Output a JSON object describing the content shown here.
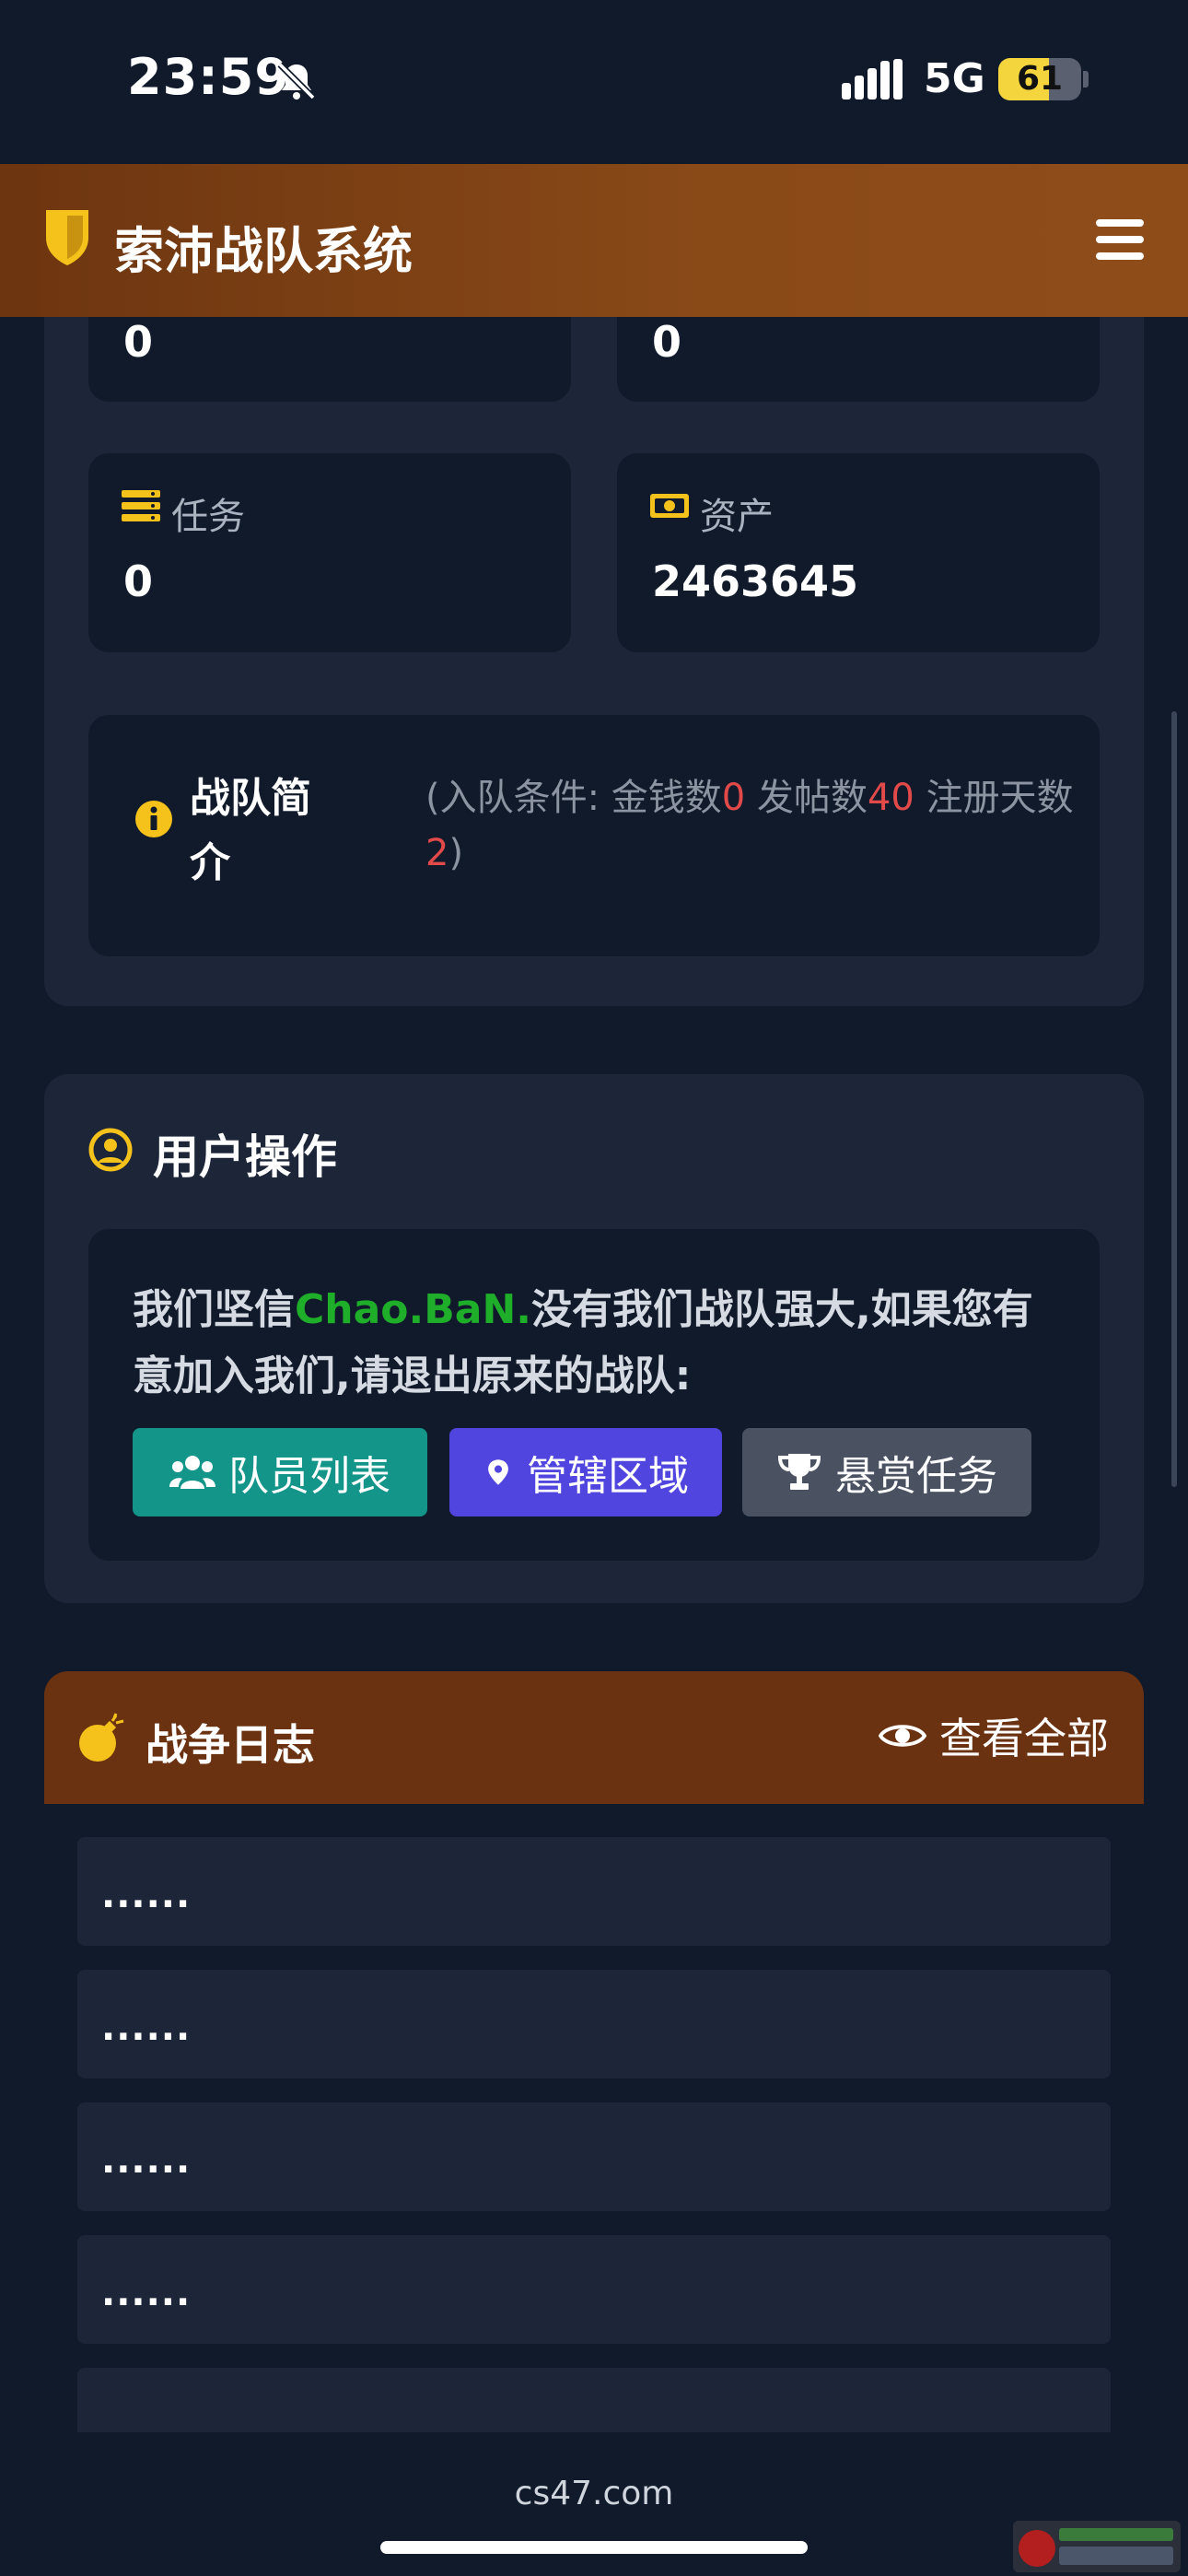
{
  "status_bar": {
    "time": "23:59",
    "network": "5G",
    "battery_level": "61",
    "battery_fraction": 0.61,
    "icons": [
      "bell-slash-icon",
      "signal-icon"
    ]
  },
  "header": {
    "title": "索沛战队系统",
    "icons": [
      "shield-icon",
      "menu-icon"
    ],
    "gradient": [
      "#6d3510",
      "#8e4c19"
    ]
  },
  "stats": {
    "top_left_value": "0",
    "top_right_value": "0",
    "tasks_label": "任务",
    "tasks_value": "0",
    "assets_label": "资产",
    "assets_value": "2463645"
  },
  "intro": {
    "title": "战队简介",
    "condition_prefix": "(入队条件: 金钱数",
    "money": "0",
    "posts_label": " 发帖数",
    "posts": "40",
    "days_label": " 注册天数",
    "days": "2",
    "suffix": ")"
  },
  "user_ops": {
    "title": "用户操作",
    "text_before": "我们坚信",
    "team_name": "Chao.BaN.",
    "text_after": "没有我们战队强大,如果您有意加入我们,请退出原来的战队:",
    "buttons": {
      "members": "队员列表",
      "region": "管辖区域",
      "bounty": "悬赏任务"
    }
  },
  "war_log": {
    "title": "战争日志",
    "view_all": "查看全部",
    "entries": [
      "......",
      "......",
      "......",
      "......",
      ""
    ]
  },
  "footer": {
    "url": "cs47.com"
  },
  "colors": {
    "accent_gold": "#f4c21a",
    "teal": "#13958a",
    "indigo": "#5145df",
    "gray": "#4a5262",
    "red": "#e24a4a",
    "green": "#1fae2a"
  }
}
